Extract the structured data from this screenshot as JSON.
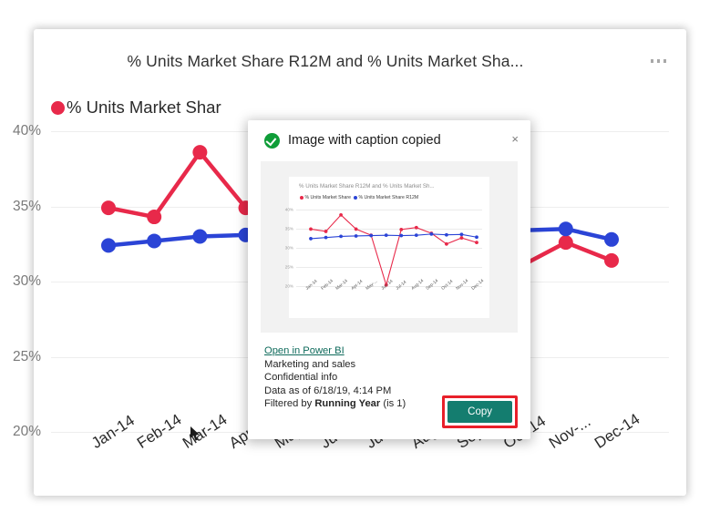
{
  "report": {
    "title": "% Units Market Share R12M and % Units Market Sha...",
    "kebab_label": "More options",
    "legend_label": "% Units Market Shar"
  },
  "dialog": {
    "title": "Image with caption copied",
    "status_icon": "check-circle-icon",
    "close_label": "×",
    "caption": {
      "link": "Open in Power BI",
      "line2": "Marketing and sales",
      "line3": "Confidential info",
      "line4": "Data as of 6/18/19, 4:14 PM",
      "filter_prefix": "Filtered by ",
      "filter_field": "Running Year",
      "filter_suffix": " (is 1)"
    },
    "copy_button": "Copy",
    "highlight_color": "#e8202a",
    "button_color": "#147d6f"
  },
  "chart_data": [
    {
      "id": "main-chart",
      "type": "line",
      "title": "% Units Market Share R12M and % Units Market Sha...",
      "xlabel": "",
      "ylabel": "",
      "ylim": [
        20,
        40
      ],
      "yticks": [
        40,
        35,
        30,
        25,
        20
      ],
      "ytick_labels": [
        "40%",
        "35%",
        "30%",
        "25%",
        "20%"
      ],
      "grid": true,
      "legend_position": "top-left",
      "categories": [
        "Jan-14",
        "Feb-14",
        "Mar-14",
        "Apr-14",
        "May-...",
        "Jun-14",
        "Jul-14",
        "Aug-14",
        "Sep-14",
        "Oct-14",
        "Nov-...",
        "Dec-14"
      ],
      "series": [
        {
          "name": "% Units Market Share",
          "color": "#e8294a",
          "values": [
            34.9,
            34.3,
            38.6,
            34.9,
            33.3,
            20.3,
            34.8,
            35.3,
            33.8,
            31.0,
            32.6,
            31.4
          ]
        },
        {
          "name": "% Units Market Share R12M",
          "color": "#2b44d6",
          "values": [
            32.4,
            32.7,
            33.0,
            33.1,
            33.2,
            33.3,
            33.2,
            33.3,
            33.6,
            33.4,
            33.5,
            32.8
          ]
        }
      ]
    },
    {
      "id": "preview-thumbnail-chart",
      "type": "line",
      "title": "% Units Market Share R12M and % Units Market Sh...",
      "xlabel": "",
      "ylabel": "",
      "ylim": [
        20,
        40
      ],
      "yticks": [
        40,
        35,
        30,
        25,
        20
      ],
      "ytick_labels": [
        "40%",
        "35%",
        "30%",
        "25%",
        "20%"
      ],
      "grid": true,
      "legend_position": "top-left",
      "categories": [
        "Jan-14",
        "Feb-14",
        "Mar-14",
        "Apr-14",
        "May-...",
        "Jun-14",
        "Jul-14",
        "Aug-14",
        "Sep-14",
        "Oct-14",
        "Nov-14",
        "Dec-14"
      ],
      "series": [
        {
          "name": "% Units Market Share",
          "color": "#e8294a",
          "values": [
            34.9,
            34.3,
            38.6,
            34.9,
            33.3,
            20.3,
            34.8,
            35.3,
            33.8,
            31.0,
            32.6,
            31.4
          ]
        },
        {
          "name": "% Units Market Share R12M",
          "color": "#2b44d6",
          "values": [
            32.4,
            32.7,
            33.0,
            33.1,
            33.2,
            33.3,
            33.2,
            33.3,
            33.6,
            33.4,
            33.5,
            32.8
          ]
        }
      ]
    }
  ]
}
